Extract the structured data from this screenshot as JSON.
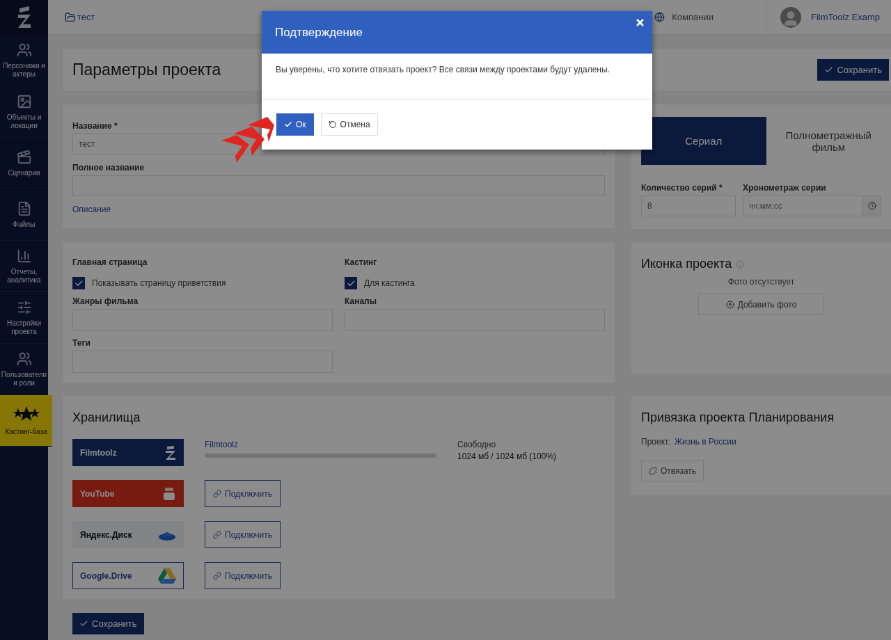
{
  "sidebar": {
    "items": [
      {
        "label": "Персонажи и актеры",
        "selected": false
      },
      {
        "label": "Объекты и локации",
        "selected": false
      },
      {
        "label": "Сценарии",
        "selected": false
      },
      {
        "label": "Файлы",
        "selected": false
      },
      {
        "label": "Отчеты, аналитика",
        "selected": false
      },
      {
        "label": "Настройки проекта",
        "selected": false
      },
      {
        "label": "Пользователи и роли",
        "selected": false
      },
      {
        "label": "Кастинг-база",
        "selected": true
      }
    ]
  },
  "topbar": {
    "breadcrumb": "тест",
    "companies": "Компании",
    "user": "FilmToolz Examp"
  },
  "header": {
    "title": "Параметры проекта",
    "save": "Сохранить"
  },
  "general": {
    "fields": [
      {
        "label": "Название *",
        "value": "тест"
      },
      {
        "label": "Полное название"
      }
    ],
    "description_link": "Описание"
  },
  "type_tabs": [
    {
      "label": "Сериал",
      "selected": true
    },
    {
      "label": "Полнометражный фильм",
      "selected": false
    }
  ],
  "series_fields": [
    {
      "label": "Количество серий *",
      "value": "8",
      "kind": "text"
    },
    {
      "label": "Хронометраж серии",
      "placeholder": "чч:мм:сс",
      "kind": "time"
    }
  ],
  "settings": [
    {
      "heading": "Главная страница",
      "checkbox": {
        "label": "Показывать страницу приветствия",
        "checked": true
      },
      "fields": [
        {
          "label": "Жанры фильма"
        },
        {
          "label": "Теги"
        }
      ]
    },
    {
      "heading": "Кастинг",
      "checkbox": {
        "label": "Для кастинга",
        "checked": true
      },
      "fields": [
        {
          "label": "Каналы"
        }
      ]
    }
  ],
  "project_icon": {
    "title": "Иконка проекта",
    "empty_text": "Фото отсутствует",
    "button": "Добавить фото"
  },
  "storages": {
    "title": "Хранилища",
    "items": [
      {
        "name": "Filmtoolz",
        "kind": "filmtoolz",
        "label": "Filmtoolz",
        "free_label": "Свободно",
        "free_value": "1024 мб / 1024 мб (100%)"
      },
      {
        "name": "YouTube",
        "kind": "youtube",
        "button": "Подключить"
      },
      {
        "name": "Яндекс.Диск",
        "kind": "yandex",
        "button": "Подключить"
      },
      {
        "name": "Google.Drive",
        "kind": "google",
        "button": "Подключить"
      }
    ]
  },
  "planning": {
    "title": "Привязка проекта Планирования",
    "project_label": "Проект:",
    "project_link": "Жизнь в России",
    "button": "Отвязать"
  },
  "footer_save": "Сохранить",
  "dialog": {
    "title": "Подтверждение",
    "message": "Вы уверены, что хотите отвязать проект? Все связи между проектами будут удалены.",
    "ok": "Ок",
    "cancel": "Отмена"
  }
}
